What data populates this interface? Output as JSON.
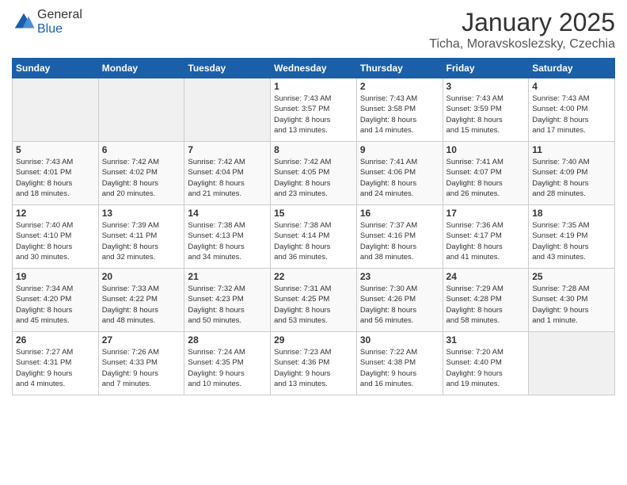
{
  "header": {
    "logo_general": "General",
    "logo_blue": "Blue",
    "month": "January 2025",
    "location": "Ticha, Moravskoslezsky, Czechia"
  },
  "days_of_week": [
    "Sunday",
    "Monday",
    "Tuesday",
    "Wednesday",
    "Thursday",
    "Friday",
    "Saturday"
  ],
  "weeks": [
    [
      {
        "day": "",
        "content": ""
      },
      {
        "day": "",
        "content": ""
      },
      {
        "day": "",
        "content": ""
      },
      {
        "day": "1",
        "content": "Sunrise: 7:43 AM\nSunset: 3:57 PM\nDaylight: 8 hours\nand 13 minutes."
      },
      {
        "day": "2",
        "content": "Sunrise: 7:43 AM\nSunset: 3:58 PM\nDaylight: 8 hours\nand 14 minutes."
      },
      {
        "day": "3",
        "content": "Sunrise: 7:43 AM\nSunset: 3:59 PM\nDaylight: 8 hours\nand 15 minutes."
      },
      {
        "day": "4",
        "content": "Sunrise: 7:43 AM\nSunset: 4:00 PM\nDaylight: 8 hours\nand 17 minutes."
      }
    ],
    [
      {
        "day": "5",
        "content": "Sunrise: 7:43 AM\nSunset: 4:01 PM\nDaylight: 8 hours\nand 18 minutes."
      },
      {
        "day": "6",
        "content": "Sunrise: 7:42 AM\nSunset: 4:02 PM\nDaylight: 8 hours\nand 20 minutes."
      },
      {
        "day": "7",
        "content": "Sunrise: 7:42 AM\nSunset: 4:04 PM\nDaylight: 8 hours\nand 21 minutes."
      },
      {
        "day": "8",
        "content": "Sunrise: 7:42 AM\nSunset: 4:05 PM\nDaylight: 8 hours\nand 23 minutes."
      },
      {
        "day": "9",
        "content": "Sunrise: 7:41 AM\nSunset: 4:06 PM\nDaylight: 8 hours\nand 24 minutes."
      },
      {
        "day": "10",
        "content": "Sunrise: 7:41 AM\nSunset: 4:07 PM\nDaylight: 8 hours\nand 26 minutes."
      },
      {
        "day": "11",
        "content": "Sunrise: 7:40 AM\nSunset: 4:09 PM\nDaylight: 8 hours\nand 28 minutes."
      }
    ],
    [
      {
        "day": "12",
        "content": "Sunrise: 7:40 AM\nSunset: 4:10 PM\nDaylight: 8 hours\nand 30 minutes."
      },
      {
        "day": "13",
        "content": "Sunrise: 7:39 AM\nSunset: 4:11 PM\nDaylight: 8 hours\nand 32 minutes."
      },
      {
        "day": "14",
        "content": "Sunrise: 7:38 AM\nSunset: 4:13 PM\nDaylight: 8 hours\nand 34 minutes."
      },
      {
        "day": "15",
        "content": "Sunrise: 7:38 AM\nSunset: 4:14 PM\nDaylight: 8 hours\nand 36 minutes."
      },
      {
        "day": "16",
        "content": "Sunrise: 7:37 AM\nSunset: 4:16 PM\nDaylight: 8 hours\nand 38 minutes."
      },
      {
        "day": "17",
        "content": "Sunrise: 7:36 AM\nSunset: 4:17 PM\nDaylight: 8 hours\nand 41 minutes."
      },
      {
        "day": "18",
        "content": "Sunrise: 7:35 AM\nSunset: 4:19 PM\nDaylight: 8 hours\nand 43 minutes."
      }
    ],
    [
      {
        "day": "19",
        "content": "Sunrise: 7:34 AM\nSunset: 4:20 PM\nDaylight: 8 hours\nand 45 minutes."
      },
      {
        "day": "20",
        "content": "Sunrise: 7:33 AM\nSunset: 4:22 PM\nDaylight: 8 hours\nand 48 minutes."
      },
      {
        "day": "21",
        "content": "Sunrise: 7:32 AM\nSunset: 4:23 PM\nDaylight: 8 hours\nand 50 minutes."
      },
      {
        "day": "22",
        "content": "Sunrise: 7:31 AM\nSunset: 4:25 PM\nDaylight: 8 hours\nand 53 minutes."
      },
      {
        "day": "23",
        "content": "Sunrise: 7:30 AM\nSunset: 4:26 PM\nDaylight: 8 hours\nand 56 minutes."
      },
      {
        "day": "24",
        "content": "Sunrise: 7:29 AM\nSunset: 4:28 PM\nDaylight: 8 hours\nand 58 minutes."
      },
      {
        "day": "25",
        "content": "Sunrise: 7:28 AM\nSunset: 4:30 PM\nDaylight: 9 hours\nand 1 minute."
      }
    ],
    [
      {
        "day": "26",
        "content": "Sunrise: 7:27 AM\nSunset: 4:31 PM\nDaylight: 9 hours\nand 4 minutes."
      },
      {
        "day": "27",
        "content": "Sunrise: 7:26 AM\nSunset: 4:33 PM\nDaylight: 9 hours\nand 7 minutes."
      },
      {
        "day": "28",
        "content": "Sunrise: 7:24 AM\nSunset: 4:35 PM\nDaylight: 9 hours\nand 10 minutes."
      },
      {
        "day": "29",
        "content": "Sunrise: 7:23 AM\nSunset: 4:36 PM\nDaylight: 9 hours\nand 13 minutes."
      },
      {
        "day": "30",
        "content": "Sunrise: 7:22 AM\nSunset: 4:38 PM\nDaylight: 9 hours\nand 16 minutes."
      },
      {
        "day": "31",
        "content": "Sunrise: 7:20 AM\nSunset: 4:40 PM\nDaylight: 9 hours\nand 19 minutes."
      },
      {
        "day": "",
        "content": ""
      }
    ]
  ]
}
